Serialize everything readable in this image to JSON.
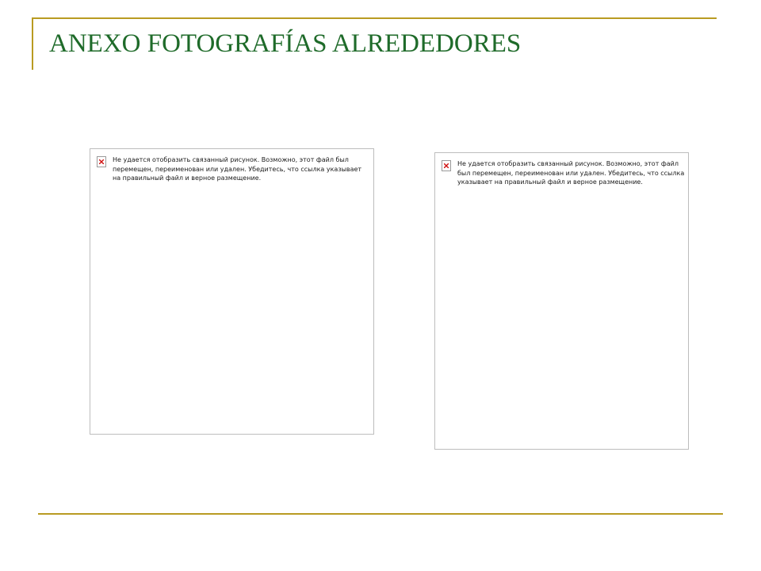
{
  "slide": {
    "title": "ANEXO FOTOGRAFÍAS ALREDEDORES"
  },
  "images": [
    {
      "icon": "broken-image-icon",
      "message": "Не удается отобразить связанный рисунок. Возможно, этот файл был перемещен, переименован или удален. Убедитесь, что ссылка указывает на правильный файл и верное размещение."
    },
    {
      "icon": "broken-image-icon",
      "message": "Не удается отобразить связанный рисунок. Возможно, этот файл был перемещен, переименован или удален. Убедитесь, что ссылка указывает на правильный файл и верное размещение."
    }
  ],
  "colors": {
    "accent_rule": "#b99b22",
    "title": "#1f6b2a",
    "error_x": "#d01010"
  }
}
